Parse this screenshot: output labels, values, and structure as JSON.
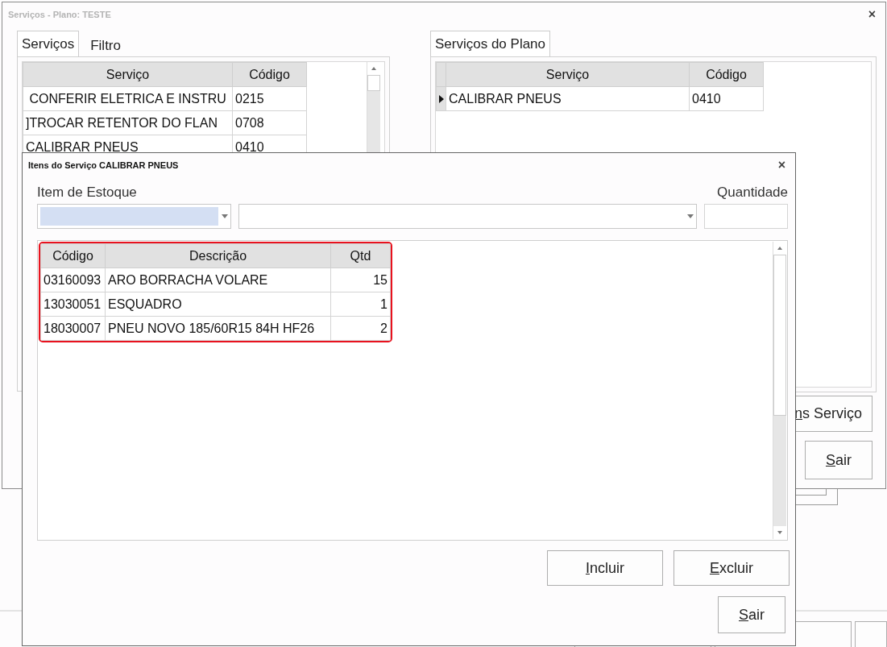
{
  "back_window": {
    "title": "Serviços - Plano: TESTE",
    "close": "×",
    "left_tabs": [
      {
        "label": "Serviços",
        "selected": true
      },
      {
        "label": "Filtro",
        "selected": false
      }
    ],
    "services_table": {
      "columns": [
        "Serviço",
        "Código"
      ],
      "rows": [
        {
          "cells": [
            " CONFERIR ELETRICA E INSTRU",
            "0215"
          ]
        },
        {
          "cells": [
            "]TROCAR RETENTOR DO FLAN",
            "0708"
          ]
        },
        {
          "cells": [
            "CALIBRAR PNEUS",
            "0410"
          ]
        }
      ]
    },
    "right_tabs": [
      {
        "label": "Serviços do Plano",
        "selected": true
      }
    ],
    "plan_table": {
      "columns": [
        "Serviço",
        "Código"
      ],
      "rows": [
        {
          "cells": [
            "CALIBRAR PNEUS",
            "0410"
          ],
          "current": true
        }
      ]
    },
    "buttons": [
      "ns Serviço",
      "Sair"
    ]
  },
  "dialog": {
    "title": "Itens do Serviço CALIBRAR PNEUS",
    "close": "×",
    "item_label": "Item de Estoque",
    "quantity_label": "Quantidade",
    "item_focused": true,
    "items_table": {
      "columns": [
        "Código",
        "Descrição",
        "Qtd"
      ],
      "rows": [
        {
          "cells": [
            "03160093",
            "ARO BORRACHA VOLARE",
            "15"
          ]
        },
        {
          "cells": [
            "13030051",
            "ESQUADRO",
            "1"
          ]
        },
        {
          "cells": [
            "18030007",
            "PNEU NOVO 185/60R15 84H HF26",
            "2"
          ]
        }
      ]
    },
    "buttons": [
      "Incluir",
      "Excluir"
    ],
    "exit": "Sair"
  }
}
